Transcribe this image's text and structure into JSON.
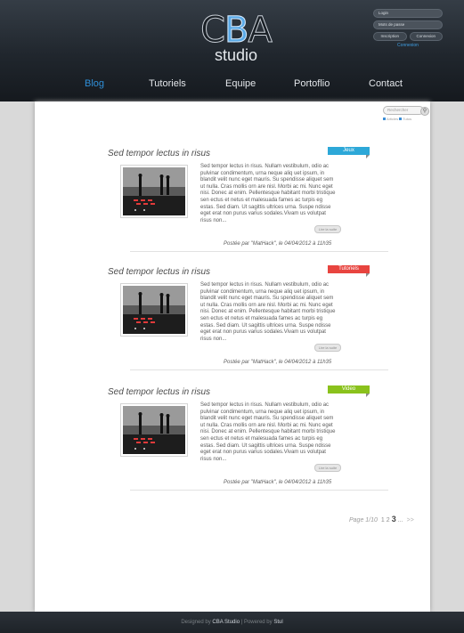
{
  "header": {
    "logo_main_c": "C",
    "logo_main_b": "B",
    "logo_main_a": "A",
    "logo_sub": "studio"
  },
  "login": {
    "login_placeholder": "Login",
    "password_placeholder": "Mots de passe",
    "register_label": "Inscription",
    "connect_label": "Connexion",
    "link_label": "Connexion"
  },
  "nav": {
    "items": [
      {
        "label": "Blog",
        "active": true
      },
      {
        "label": "Tutoriels"
      },
      {
        "label": "Equipe"
      },
      {
        "label": "Portoflio"
      },
      {
        "label": "Contact"
      }
    ]
  },
  "search": {
    "placeholder": "Rechercher",
    "option_1": "Articles",
    "option_2": "Tutos"
  },
  "posts": [
    {
      "title": "Sed tempor lectus in risus",
      "tag": "Jeux",
      "tag_color": "#2da8d8",
      "excerpt": "Sed tempor lectus in risus. Nullam vestibulum, odio ac pulvinar condimentum, urna neque aliq uet ipsum, in blandit velit nunc eget mauris. Su spendisse aliquet sem ut nulla. Cras mollis orn are nisl. Morbi ac mi. Nunc eget nisi. Donec at enim. Pellentesque habitant morbi tristique sen ectus et netus et malesuada fames ac turpis eg estas. Sed diam. Ut sagittis ultrices urna. Suspe ndisse eget erat non purus varius sodales.Vivam us volutpat risus non...",
      "more_label": "Lire la suite",
      "byline": "Postée par \"MatHack\", le 04/04/2012 à 11h35"
    },
    {
      "title": "Sed tempor lectus in risus",
      "tag": "Tutoriels",
      "tag_color": "#e8443f",
      "excerpt": "Sed tempor lectus in risus. Nullam vestibulum, odio ac pulvinar condimentum, urna neque aliq uet ipsum, in blandit velit nunc eget mauris. Su spendisse aliquet sem ut nulla. Cras mollis orn are nisl. Morbi ac mi. Nunc eget nisi. Donec at enim. Pellentesque habitant morbi tristique sen ectus et netus et malesuada fames ac turpis eg estas. Sed diam. Ut sagittis ultrices urna. Suspe ndisse eget erat non purus varius sodales.Vivam us volutpat risus non...",
      "more_label": "Lire la suite",
      "byline": "Postée par \"MatHack\", le 04/04/2012 à 11h35"
    },
    {
      "title": "Sed tempor lectus in risus",
      "tag": "Video",
      "tag_color": "#8ac21c",
      "excerpt": "Sed tempor lectus in risus. Nullam vestibulum, odio ac pulvinar condimentum, urna neque aliq uet ipsum, in blandit velit nunc eget mauris. Su spendisse aliquet sem ut nulla. Cras mollis orn are nisl. Morbi ac mi. Nunc eget nisi. Donec at enim. Pellentesque habitant morbi tristique sen ectus et netus et malesuada fames ac turpis eg estas. Sed diam. Ut sagittis ultrices urna. Suspe ndisse eget erat non purus varius sodales.Vivam us volutpat risus non...",
      "more_label": "Lire la suite",
      "byline": "Postée par \"MatHack\", le 04/04/2012 à 11h35"
    }
  ],
  "pagination": {
    "label": "Page 1/10",
    "pages": [
      "1",
      "2",
      "3",
      "..."
    ],
    "current": "3",
    "next": ">>"
  },
  "footer": {
    "prefix": "Designed by ",
    "brand": "CBA Studio",
    "middle": " | Powered by ",
    "engine": "Stul"
  }
}
